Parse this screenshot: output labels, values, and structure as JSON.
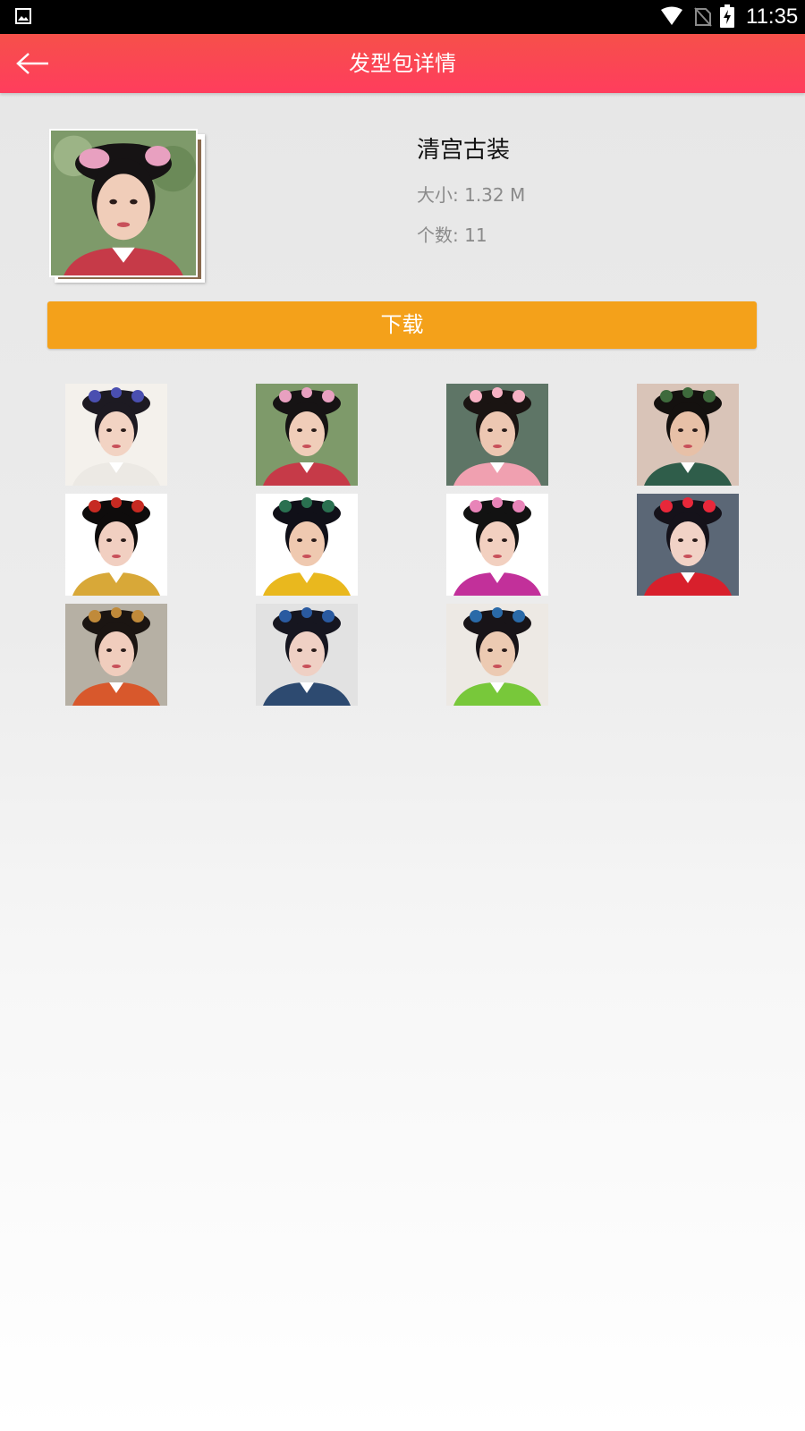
{
  "status_bar": {
    "time": "11:35",
    "icons": [
      "gallery-icon",
      "wifi-icon",
      "no-sim-icon",
      "battery-charging-icon"
    ]
  },
  "header": {
    "title": "发型包详情",
    "back_icon": "back-arrow-icon"
  },
  "pack": {
    "name": "清宫古装",
    "size_text": "大小: 1.32 M",
    "count_text": "个数: 11"
  },
  "download_label": "下载",
  "colors": {
    "accent": "#ff3d5d",
    "download": "#f4a11a"
  },
  "thumbnails": [
    {
      "name": "hairstyle-1",
      "bg": "#f4f1ec",
      "hair": "#1d1a22",
      "skin": "#f2d3c3",
      "robe": "#ece9e4",
      "ornament": "#4a4fb0"
    },
    {
      "name": "hairstyle-2",
      "bg": "#7e9a6a",
      "hair": "#161314",
      "skin": "#f0cdb9",
      "robe": "#c63a48",
      "ornament": "#e8a0c0"
    },
    {
      "name": "hairstyle-3",
      "bg": "#5e7566",
      "hair": "#1a1412",
      "skin": "#edc7b2",
      "robe": "#f0a0b0",
      "ornament": "#f7b2c4"
    },
    {
      "name": "hairstyle-4",
      "bg": "#d9c4b8",
      "hair": "#14110f",
      "skin": "#e7c0a7",
      "robe": "#2f5d4a",
      "ornament": "#3e6a3c"
    },
    {
      "name": "hairstyle-5",
      "bg": "#ffffff",
      "hair": "#0e0c0c",
      "skin": "#f1cfc1",
      "robe": "#d8a838",
      "ornament": "#c62a22"
    },
    {
      "name": "hairstyle-6",
      "bg": "#ffffff",
      "hair": "#101018",
      "skin": "#efc9b0",
      "robe": "#e9b81e",
      "ornament": "#2a7050"
    },
    {
      "name": "hairstyle-7",
      "bg": "#ffffff",
      "hair": "#121212",
      "skin": "#f2d0c0",
      "robe": "#c2309a",
      "ornament": "#e884b8"
    },
    {
      "name": "hairstyle-8",
      "bg": "#5b6776",
      "hair": "#15121a",
      "skin": "#f1d2c6",
      "robe": "#d8202c",
      "ornament": "#e8283a"
    },
    {
      "name": "hairstyle-9",
      "bg": "#b6b0a4",
      "hair": "#1b1512",
      "skin": "#f0cdbd",
      "robe": "#d8582c",
      "ornament": "#c08a3a"
    },
    {
      "name": "hairstyle-10",
      "bg": "#e2e2e2",
      "hair": "#161620",
      "skin": "#efd0c4",
      "robe": "#2d4a70",
      "ornament": "#2a5aa0"
    },
    {
      "name": "hairstyle-11",
      "bg": "#ede9e4",
      "hair": "#181418",
      "skin": "#eccab2",
      "robe": "#78c83a",
      "ornament": "#2a6aa8"
    }
  ]
}
